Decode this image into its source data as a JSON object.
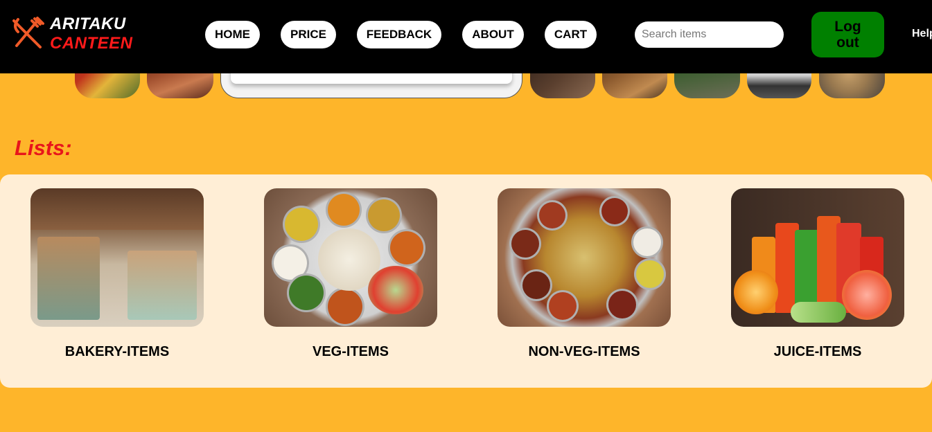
{
  "header": {
    "logo": {
      "line1": "ARITAKU",
      "line2": "CANTEEN",
      "icon": "fork-knife-icon"
    },
    "nav": [
      {
        "label": "HOME"
      },
      {
        "label": "PRICE"
      },
      {
        "label": "FEEDBACK"
      },
      {
        "label": "ABOUT"
      },
      {
        "label": "CART"
      }
    ],
    "search": {
      "placeholder": "Search items",
      "value": ""
    },
    "logout": {
      "label": "Log\nout"
    },
    "help": {
      "label": "Help"
    }
  },
  "lists": {
    "heading": "Lists:",
    "items": [
      {
        "label": "BAKERY-ITEMS"
      },
      {
        "label": "VEG-ITEMS"
      },
      {
        "label": "NON-VEG-ITEMS"
      },
      {
        "label": "JUICE-ITEMS"
      }
    ]
  },
  "colors": {
    "background": "#FEB52A",
    "header": "#000000",
    "panel": "#FFEED6",
    "logout": "#008000",
    "accent_red": "#E8151B",
    "logo_orange": "#F05A28"
  }
}
